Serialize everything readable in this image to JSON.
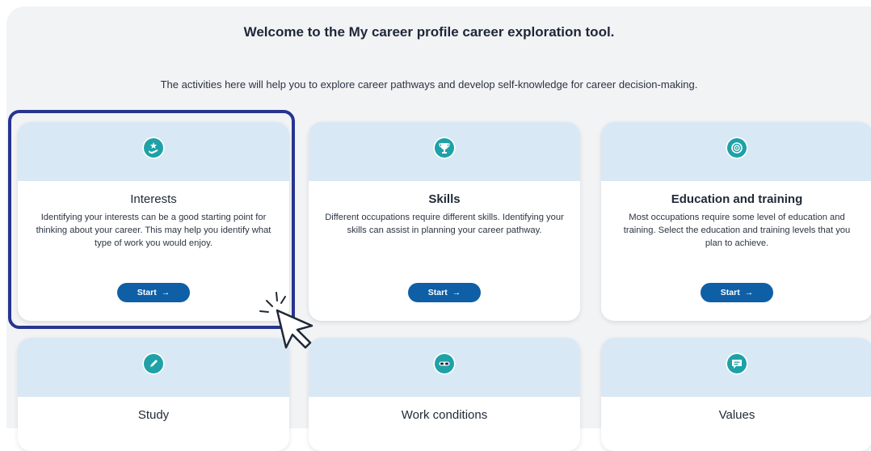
{
  "header": {
    "title": "Welcome to the My career profile career exploration tool.",
    "subtitle": "The activities here will help you to explore career pathways and develop self-knowledge for career decision-making."
  },
  "cards": [
    {
      "title": "Interests",
      "description": "Identifying your interests can be a good starting point for thinking about your career. This may help you identify what type of work you would enjoy.",
      "button": "Start",
      "icon": "hand-star-icon"
    },
    {
      "title": "Skills",
      "description": "Different occupations require different skills. Identifying your skills can assist in planning your career pathway.",
      "button": "Start",
      "icon": "trophy-icon"
    },
    {
      "title": "Education and training",
      "description": "Most occupations require some level of education and training. Select the education and training levels that you plan to achieve.",
      "button": "Start",
      "icon": "award-icon"
    },
    {
      "title": "Study",
      "icon": "pencil-icon"
    },
    {
      "title": "Work conditions",
      "icon": "goggles-icon"
    },
    {
      "title": "Values",
      "icon": "speech-bubble-icon"
    }
  ],
  "colors": {
    "accent": "#0f5fa6",
    "icon": "#1fa1a8",
    "card_header": "#d9e8f5",
    "highlight": "#27358f"
  },
  "button_arrow": "→"
}
